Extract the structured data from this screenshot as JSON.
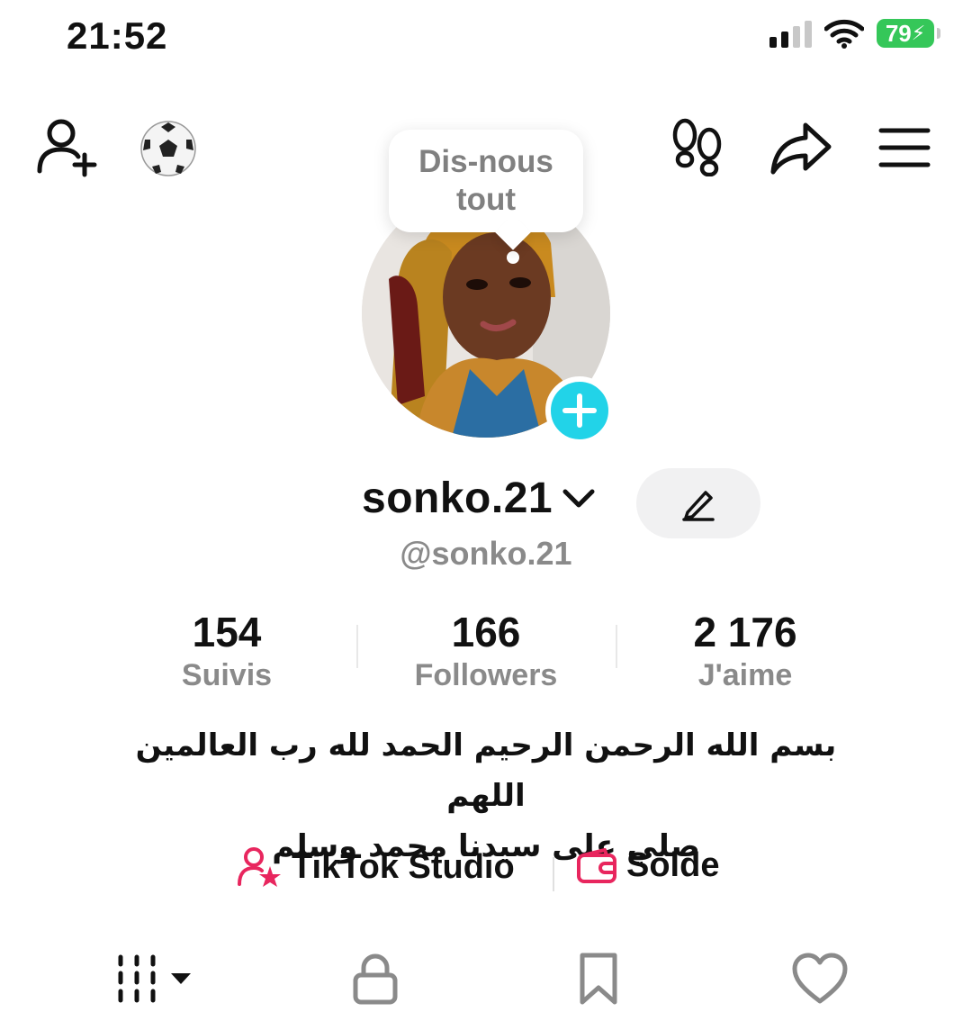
{
  "status_bar": {
    "time": "21:52",
    "battery": "79"
  },
  "top_bar": {
    "icons": [
      "add-friend-icon",
      "football-icon",
      "footprints-icon",
      "share-icon",
      "menu-icon"
    ]
  },
  "tooltip": {
    "text": "Dis-nous\ntout"
  },
  "profile": {
    "username": "sonko.21",
    "handle": "@sonko.21",
    "accent": "#22d3e8"
  },
  "stats": [
    {
      "value": "154",
      "label": "Suivis"
    },
    {
      "value": "166",
      "label": "Followers"
    },
    {
      "value": "2 176",
      "label": "J'aime"
    }
  ],
  "bio": {
    "line1": "بسم الله الرحمن الرحيم الحمد لله رب العالمين اللهم",
    "line2": "صلي على سيدنا محمد وسلم"
  },
  "links": {
    "studio": "TikTok Studio",
    "balance": "Solde",
    "accent": "#e8265e"
  },
  "tabs": [
    "videos-grid-icon",
    "lock-icon",
    "bookmark-icon",
    "heart-icon"
  ]
}
